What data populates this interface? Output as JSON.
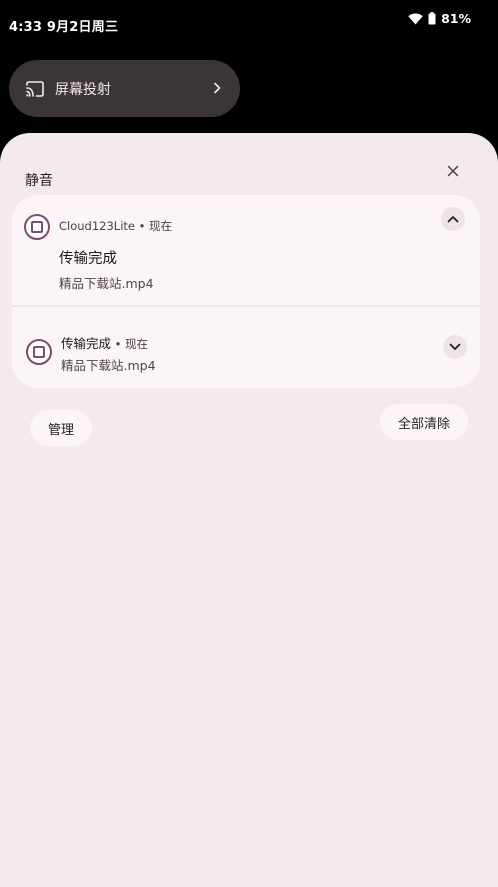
{
  "status_bar": {
    "time_date": "4:33 9月2日周三",
    "battery_percent": "81%",
    "icons": [
      "wifi-icon",
      "battery-icon"
    ]
  },
  "quick_tile": {
    "label": "屏幕投射",
    "icon": "cast-icon",
    "chevron": "chevron-right-icon"
  },
  "shade": {
    "section_title": "静音",
    "close_icon": "close-icon"
  },
  "notifications": [
    {
      "app_name": "Cloud123Lite",
      "time": "现在",
      "header": "Cloud123Lite • 现在",
      "title": "传输完成",
      "body": "精品下载站.mp4",
      "expanded": true,
      "toggle_icon": "chevron-up-icon"
    },
    {
      "title": "传输完成",
      "time_suffix": " • 现在",
      "body": "精品下载站.mp4",
      "expanded": false,
      "toggle_icon": "chevron-down-icon"
    }
  ],
  "actions": {
    "manage_label": "管理",
    "clear_all_label": "全部清除"
  },
  "colors": {
    "shade_bg": "#f4eaed",
    "card_bg": "#fbf5f7",
    "tile_bg": "#3b3537",
    "accent": "#7a4d71"
  }
}
